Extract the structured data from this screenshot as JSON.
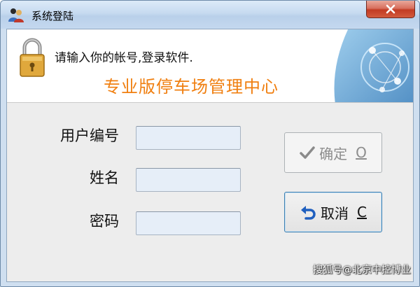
{
  "window": {
    "title": "系统登陆"
  },
  "banner": {
    "message": "请输入你的帐号,登录软件.",
    "title": "专业版停车场管理中心"
  },
  "form": {
    "user_id_label": "用户编号",
    "name_label": "姓名",
    "password_label": "密码",
    "user_id_value": "",
    "name_value": "",
    "password_value": ""
  },
  "buttons": {
    "ok_label": "确定",
    "ok_accel": "O",
    "ok_enabled": false,
    "cancel_label": "取消",
    "cancel_accel": "C"
  },
  "watermark": "搜狐号@北京中控博业",
  "icons": {
    "app": "users-icon",
    "close": "close-icon",
    "banner": "lock-icon",
    "ok": "checkmark-icon",
    "cancel": "undo-icon"
  },
  "colors": {
    "banner_title": "#f07f10",
    "close_button": "#c23b23",
    "input_bg": "#e6eef8"
  }
}
